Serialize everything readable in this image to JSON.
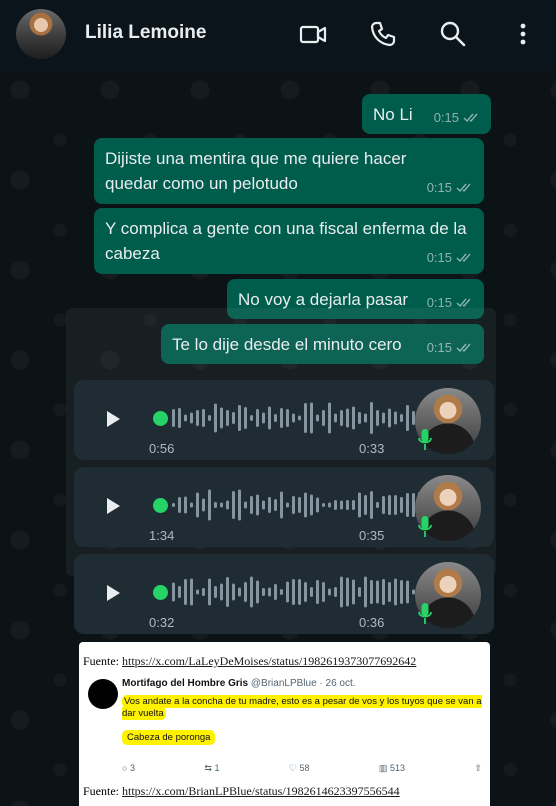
{
  "header": {
    "contact_name": "Lilia Lemoine",
    "icons": [
      "video-call-icon",
      "phone-icon",
      "search-icon",
      "more-options-icon"
    ]
  },
  "messages": [
    {
      "text": "No Li",
      "time": "0:15"
    },
    {
      "text": "Dijiste una mentira que me quiere hacer quedar como un pelotudo",
      "time": "0:15"
    },
    {
      "text": "Y complica a gente con una fiscal enferma de la cabeza",
      "time": "0:15"
    },
    {
      "text": "No voy a dejarla pasar",
      "time": "0:15"
    },
    {
      "text": "Te lo dije desde el minuto cero",
      "time": "0:15"
    }
  ],
  "voice_notes": [
    {
      "duration": "0:56",
      "time": "0:33"
    },
    {
      "duration": "1:34",
      "time": "0:35"
    },
    {
      "duration": "0:32",
      "time": "0:36"
    }
  ],
  "image_message": {
    "source_top_label": "Fuente:",
    "source_top_url": "https://x.com/LaLeyDeMoises/status/1982619373077692642",
    "tweet_author": "Mortifago del Hombre Gris",
    "tweet_handle": "@BrianLPBlue · 26 oct.",
    "tweet_text": "Vos andate a la concha de tu madre, esto es a pesar de vos y los tuyos que se van a dar vuelta",
    "tweet_text2": "Cabeza de poronga",
    "replies": "3",
    "retweets": "1",
    "likes": "58",
    "views": "513",
    "source_bottom_label": "Fuente:",
    "source_bottom_url": "https://x.com/BrianLPBlue/status/1982614623397556544"
  },
  "colors": {
    "outgoing_bubble": "#005c4b",
    "background": "#0b141a",
    "voice_bubble": "#1f2c33",
    "accent_green": "#25d366"
  }
}
